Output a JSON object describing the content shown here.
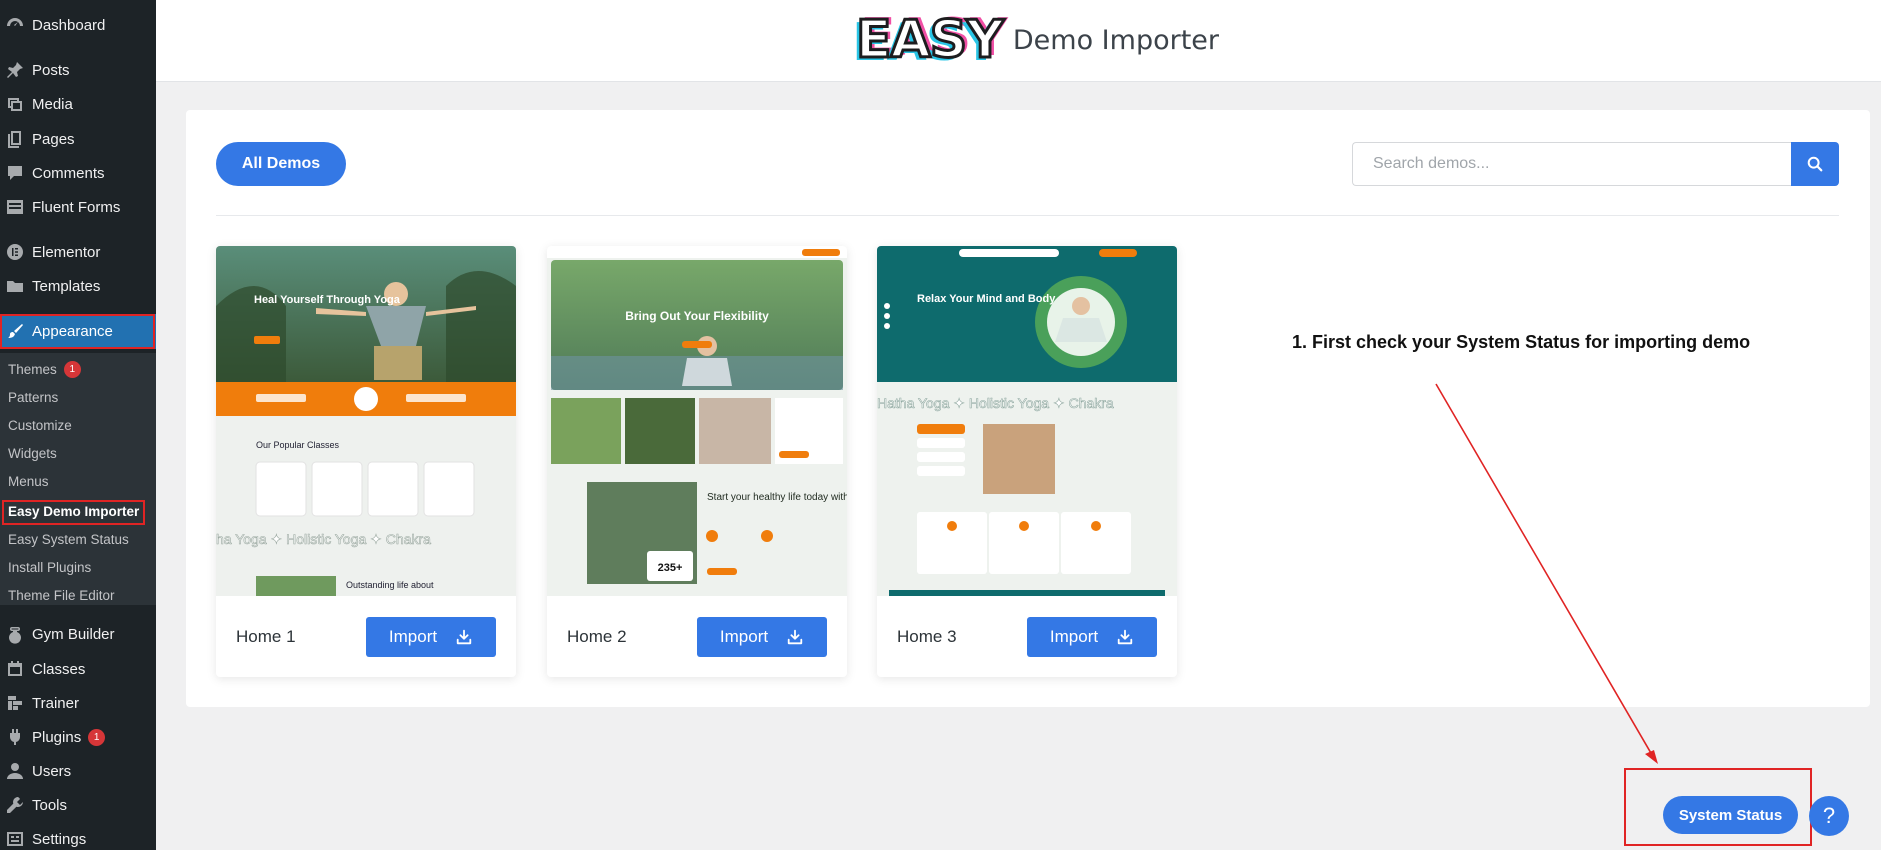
{
  "sidebar": {
    "items": [
      {
        "label": "Dashboard",
        "icon": "dashboard-icon"
      },
      {
        "label": "Posts",
        "icon": "pin-icon"
      },
      {
        "label": "Media",
        "icon": "media-icon"
      },
      {
        "label": "Pages",
        "icon": "pages-icon"
      },
      {
        "label": "Comments",
        "icon": "comment-icon"
      },
      {
        "label": "Fluent Forms",
        "icon": "forms-icon"
      },
      {
        "label": "Elementor",
        "icon": "elementor-icon"
      },
      {
        "label": "Templates",
        "icon": "folder-icon"
      },
      {
        "label": "Appearance",
        "icon": "brush-icon"
      },
      {
        "label": "Gym Builder",
        "icon": "kettlebell-icon"
      },
      {
        "label": "Classes",
        "icon": "calendar-icon"
      },
      {
        "label": "Trainer",
        "icon": "trainer-icon"
      },
      {
        "label": "Plugins",
        "icon": "plugin-icon",
        "badge": "1"
      },
      {
        "label": "Users",
        "icon": "user-icon"
      },
      {
        "label": "Tools",
        "icon": "wrench-icon"
      },
      {
        "label": "Settings",
        "icon": "settings-icon"
      }
    ],
    "submenu": [
      {
        "label": "Themes",
        "badge": "1"
      },
      {
        "label": "Patterns"
      },
      {
        "label": "Customize"
      },
      {
        "label": "Widgets"
      },
      {
        "label": "Menus"
      },
      {
        "label": "Easy Demo Importer"
      },
      {
        "label": "Easy System Status"
      },
      {
        "label": "Install Plugins"
      },
      {
        "label": "Theme File Editor"
      }
    ]
  },
  "header": {
    "logo_mark": "EASY",
    "title": "Demo Importer"
  },
  "toolbar": {
    "all_demos_label": "All Demos",
    "search_placeholder": "Search demos..."
  },
  "demos": [
    {
      "title": "Home 1",
      "import_label": "Import",
      "preview": {
        "hero": "Heal Yourself Through Yoga",
        "section": "Our Popular Classes",
        "marquee": "ha Yoga  ✦ Holistic Yoga  ✦ Chakra",
        "teaser": "Outstanding life about"
      }
    },
    {
      "title": "Home 2",
      "import_label": "Import",
      "preview": {
        "hero": "Bring Out Your Flexibility",
        "section": "Start your healthy life today with us",
        "stat": "235+"
      }
    },
    {
      "title": "Home 3",
      "import_label": "Import",
      "preview": {
        "hero": "Relax Your Mind and Body",
        "marquee": "Hatha Yoga  ✦ Holistic Yoga  ✦ Chakra"
      }
    }
  ],
  "annotation": {
    "text": "1. First check your System Status for importing demo"
  },
  "floating": {
    "system_status_label": "System Status",
    "help_label": "?"
  },
  "colors": {
    "accent": "#3478e5",
    "sidebar": "#1d2327",
    "active_menu": "#2271b1",
    "annotation_red": "#e02424"
  }
}
